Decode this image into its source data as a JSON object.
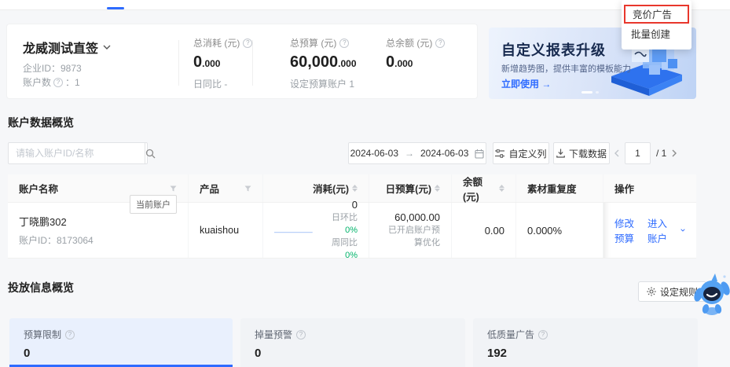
{
  "icons": {
    "help_glyph": "?"
  },
  "colors": {
    "primary": "#2E6BFF",
    "green": "#00B36A",
    "highlight_red": "#E8372C"
  },
  "dropdown": {
    "items": [
      {
        "label": "竞价广告"
      },
      {
        "label": "批量创建"
      }
    ]
  },
  "overview": {
    "account_name": "龙威测试直签",
    "company_id": "企业ID：9873",
    "account_count_prefix": "账户数",
    "account_count_suffix": "：1",
    "stats": [
      {
        "label": "总消耗 (元)",
        "int": "0",
        "dec": ".000",
        "sub": "日同比 -"
      },
      {
        "label": "总预算 (元)",
        "int": "60,000",
        "dec": ".000",
        "sub": "设定预算账户 1"
      },
      {
        "label": "总余额 (元)",
        "int": "0",
        "dec": ".000",
        "sub": ""
      }
    ]
  },
  "banner": {
    "title": "自定义报表升级",
    "subtitle": "新增趋势图，提供丰富的模板能力",
    "cta": "立即使用 →"
  },
  "accounts": {
    "title": "账户数据概览",
    "search_placeholder": "请输入账户ID/名称",
    "date_start": "2024-06-03",
    "date_arrow": "→",
    "date_end": "2024-06-03",
    "custom_columns": "自定义列",
    "download": "下载数据",
    "page_current": "1",
    "page_total": "/ 1"
  },
  "table": {
    "headers": [
      "账户名称",
      "产品",
      "消耗(元)",
      "日预算(元)",
      "余额(元)",
      "素材重复度",
      "操作"
    ],
    "row": {
      "name": "丁晓鹏302",
      "badge": "当前账户",
      "account_id": "账户ID：8173064",
      "product": "kuaishou",
      "spend": "0",
      "spend_dod_label": "日环比 ",
      "spend_dod": "0%",
      "spend_wow_label": "周同比 ",
      "spend_wow": "0%",
      "daily_budget": "60,000.00",
      "daily_budget_sub": "已开启账户预算优化",
      "balance": "0.00",
      "material_dup": "0.000%",
      "action_modify": "修改预算",
      "action_enter": "进入账户"
    }
  },
  "delivery": {
    "title": "投放信息概览",
    "rules_button": "设定规则",
    "cards": [
      {
        "label": "预算限制",
        "value": "0"
      },
      {
        "label": "掉量预警",
        "value": "0"
      },
      {
        "label": "低质量广告",
        "value": "192"
      }
    ]
  }
}
